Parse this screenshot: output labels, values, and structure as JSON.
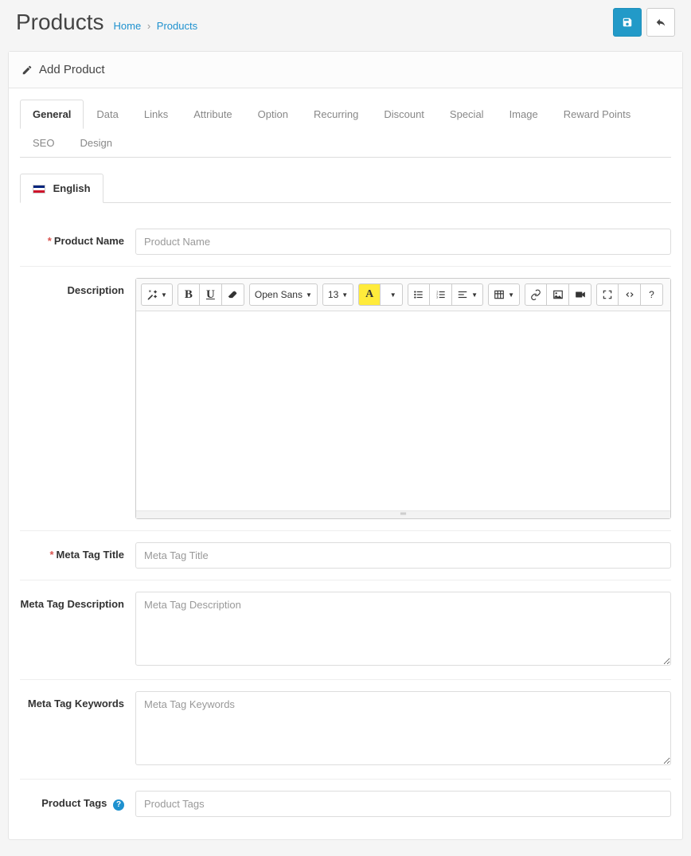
{
  "header": {
    "title": "Products",
    "breadcrumb_home": "Home",
    "breadcrumb_current": "Products"
  },
  "panel": {
    "heading": "Add Product"
  },
  "tabs": [
    {
      "label": "General",
      "active": true
    },
    {
      "label": "Data"
    },
    {
      "label": "Links"
    },
    {
      "label": "Attribute"
    },
    {
      "label": "Option"
    },
    {
      "label": "Recurring"
    },
    {
      "label": "Discount"
    },
    {
      "label": "Special"
    },
    {
      "label": "Image"
    },
    {
      "label": "Reward Points"
    },
    {
      "label": "SEO"
    },
    {
      "label": "Design"
    }
  ],
  "lang_tab": "English",
  "editor": {
    "font": "Open Sans",
    "size": "13"
  },
  "fields": {
    "product_name": {
      "label": "Product Name",
      "placeholder": "Product Name"
    },
    "description": {
      "label": "Description"
    },
    "meta_title": {
      "label": "Meta Tag Title",
      "placeholder": "Meta Tag Title"
    },
    "meta_description": {
      "label": "Meta Tag Description",
      "placeholder": "Meta Tag Description"
    },
    "meta_keywords": {
      "label": "Meta Tag Keywords",
      "placeholder": "Meta Tag Keywords"
    },
    "product_tags": {
      "label": "Product Tags",
      "placeholder": "Product Tags"
    }
  }
}
